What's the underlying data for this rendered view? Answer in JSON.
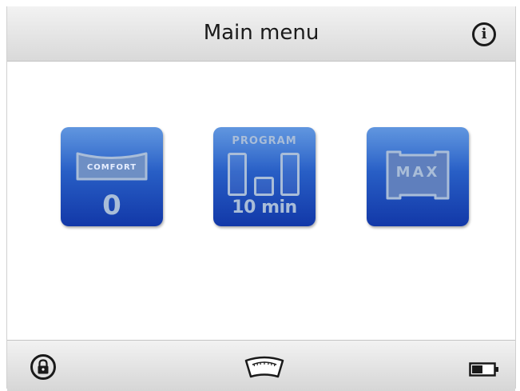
{
  "header": {
    "title": "Main menu",
    "info_icon": "info-icon",
    "info_glyph": "i"
  },
  "tiles": [
    {
      "name": "comfort",
      "label": "COMFORT",
      "value": "0",
      "icon": "comfort-cushion-icon"
    },
    {
      "name": "program",
      "label": "PROGRAM",
      "value": "10 min",
      "icon": "program-bars-icon"
    },
    {
      "name": "max",
      "label": "MAX",
      "icon": "max-icon"
    }
  ],
  "footer": {
    "lock_icon": "lock-icon",
    "gauge_icon": "gauge-icon",
    "battery_icon": "battery-icon",
    "battery_level": 0.5
  },
  "colors": {
    "tile_top": "#3e7fd8",
    "tile_bottom": "#1238a8",
    "tile_text": "#a9bdd8"
  }
}
